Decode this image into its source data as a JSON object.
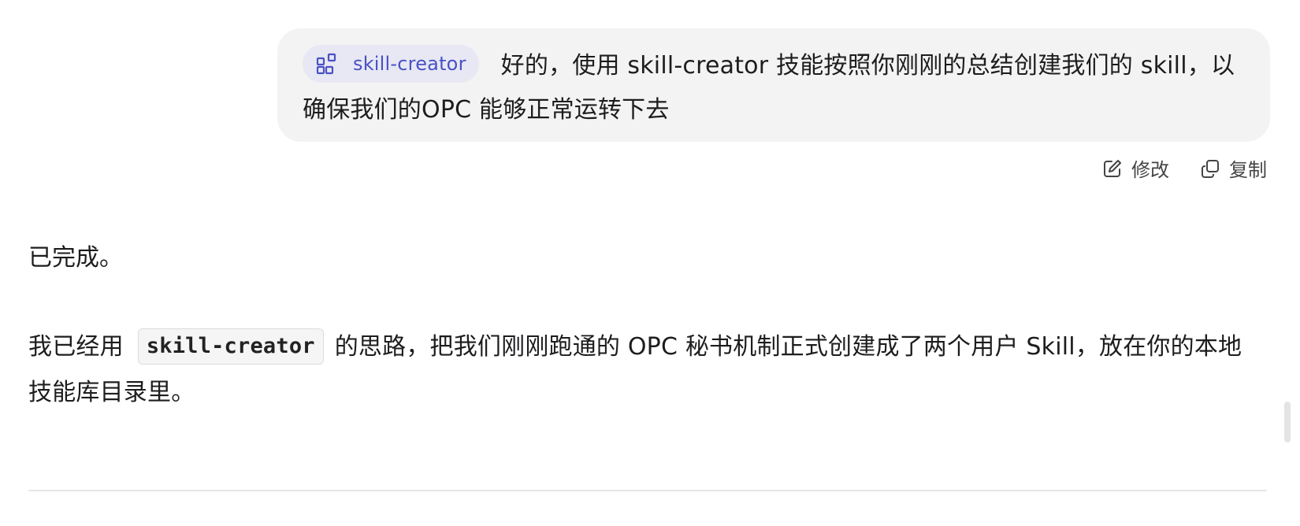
{
  "user_message": {
    "skill_chip": {
      "label": "skill-creator",
      "icon": "skill-blocks-icon",
      "color": "#4a52c4"
    },
    "text": "好的，使用 skill-creator 技能按照你刚刚的总结创建我们的 skill，以确保我们的OPC 能够正常运转下去"
  },
  "actions": {
    "edit_label": "修改",
    "copy_label": "复制"
  },
  "assistant_reply": {
    "line1": "已完成。",
    "para_before_code": "我已经用",
    "code": "skill-creator",
    "para_after_code": "的思路，把我们刚刚跑通的 OPC 秘书机制正式创建成了两个用户 Skill，放在你的本地技能库目录里。"
  }
}
